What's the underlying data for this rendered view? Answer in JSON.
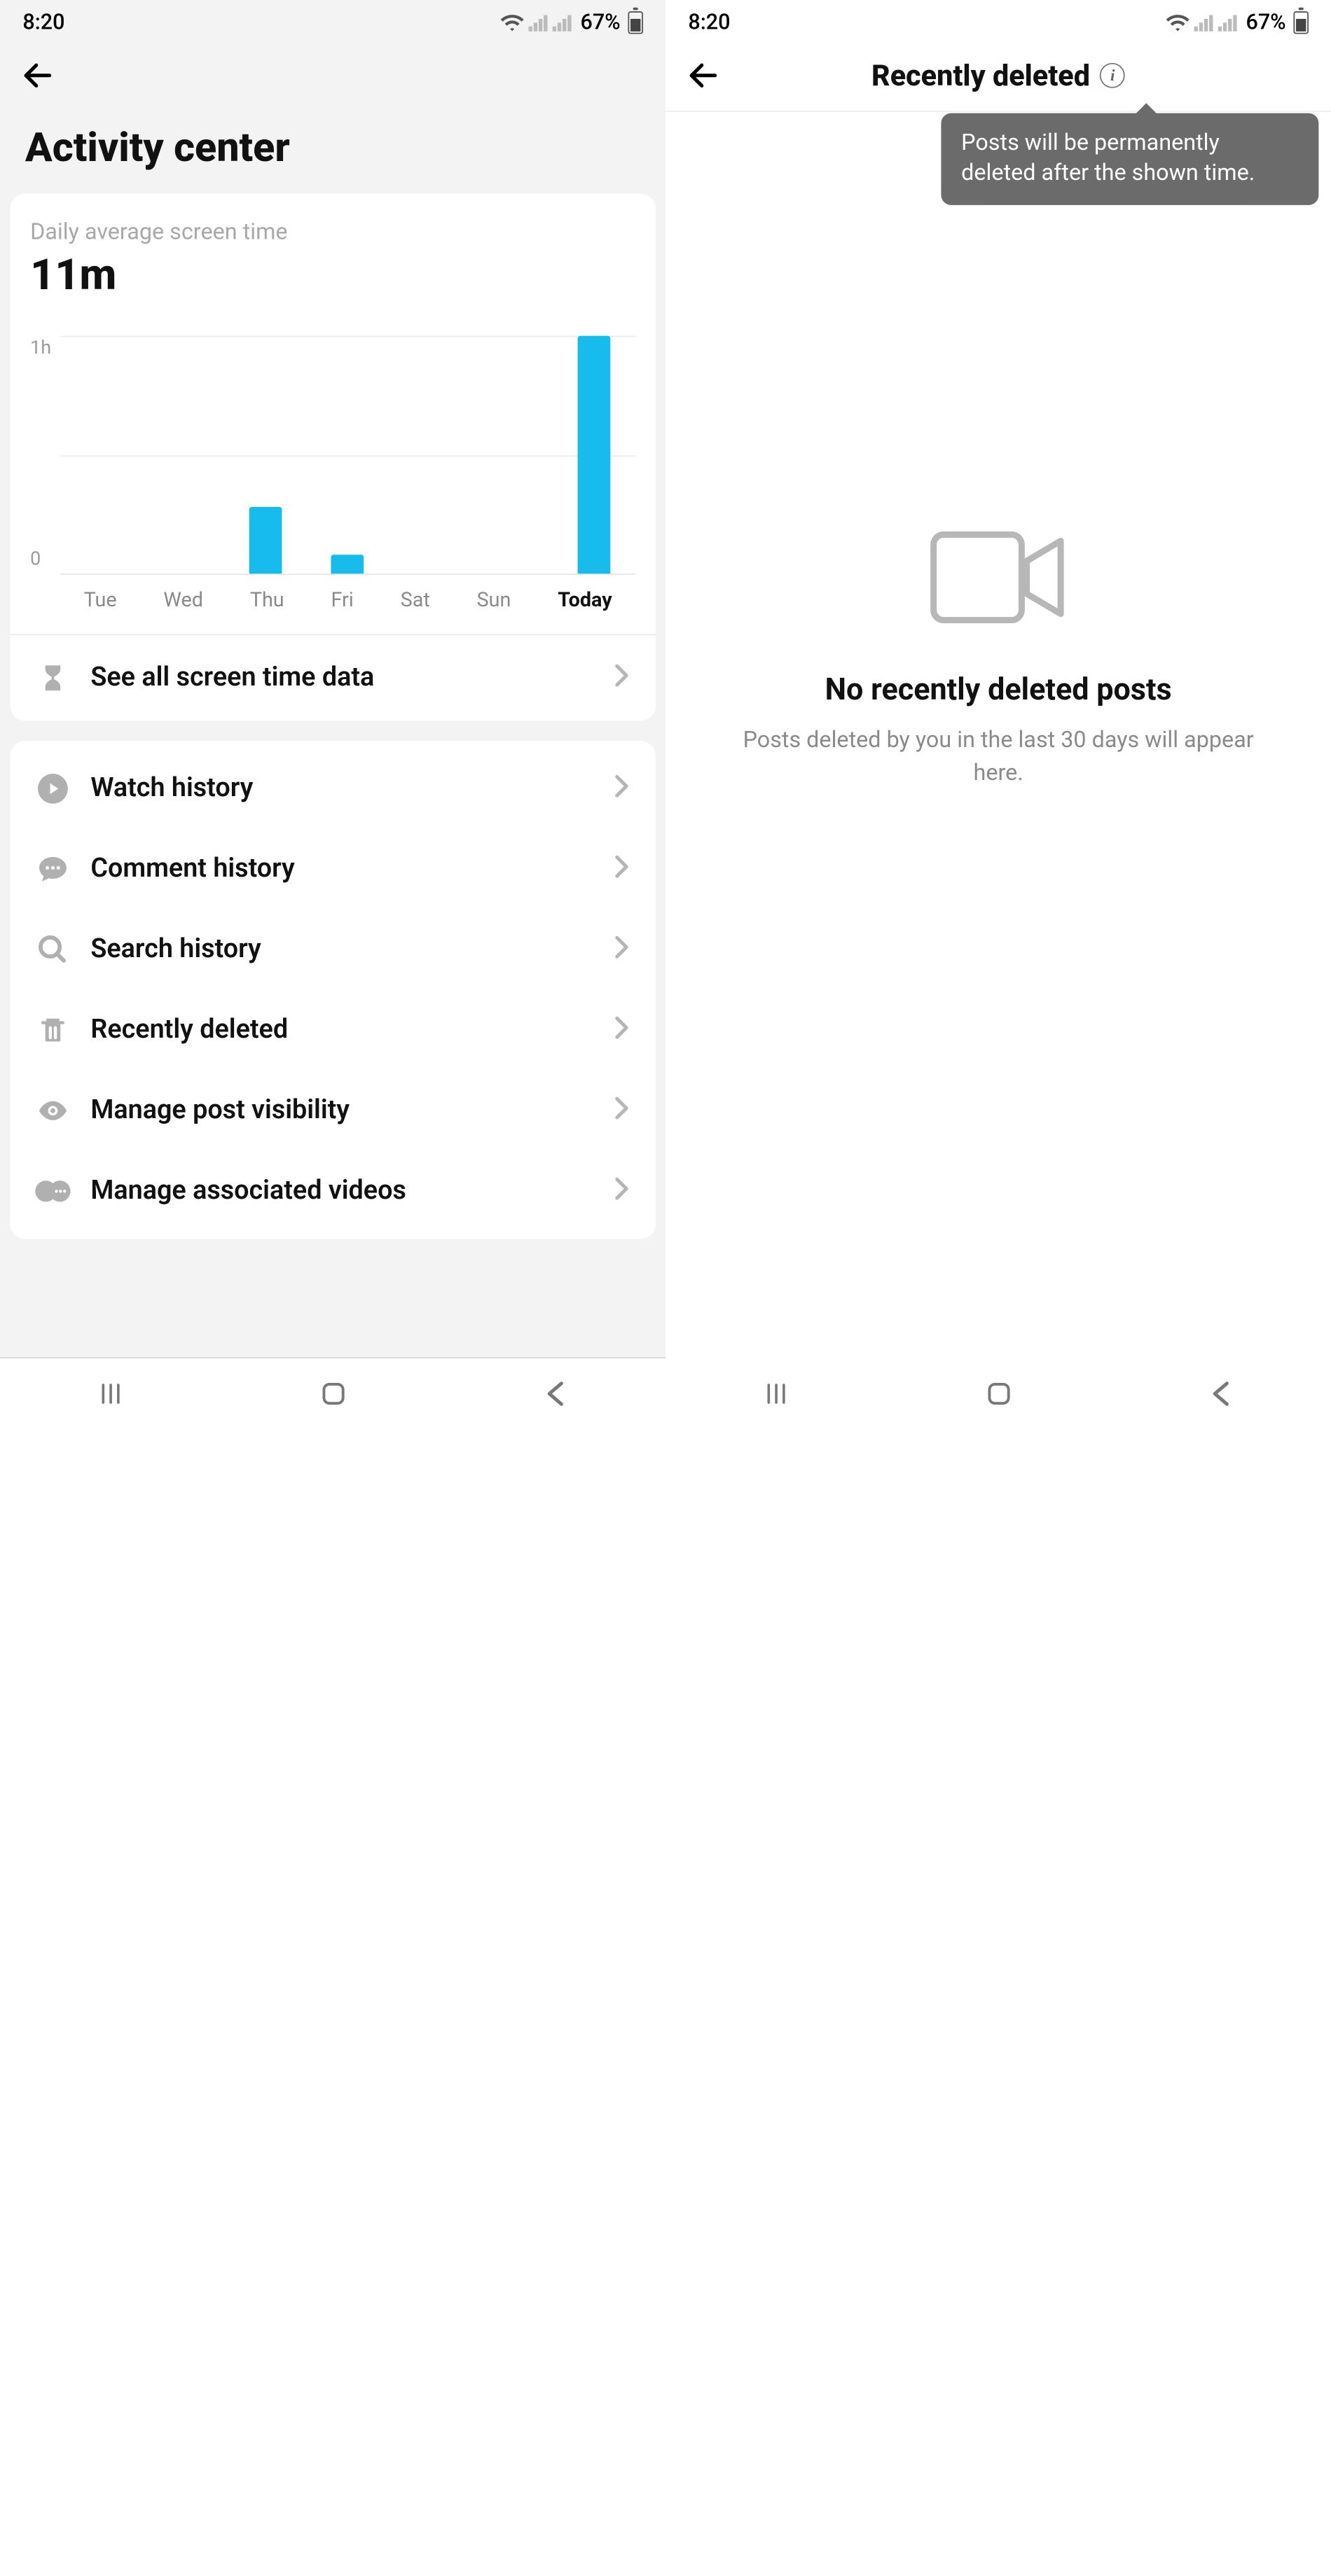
{
  "status": {
    "time": "8:20",
    "battery": "67%"
  },
  "left": {
    "title": "Activity center",
    "screen_time": {
      "label": "Daily average screen time",
      "value": "11m"
    },
    "see_all": "See all screen time data",
    "menu": [
      {
        "icon": "play",
        "label": "Watch history"
      },
      {
        "icon": "comment",
        "label": "Comment history"
      },
      {
        "icon": "search",
        "label": "Search history"
      },
      {
        "icon": "trash",
        "label": "Recently deleted"
      },
      {
        "icon": "eye",
        "label": "Manage post visibility"
      },
      {
        "icon": "link-vid",
        "label": "Manage associated videos"
      }
    ]
  },
  "right": {
    "title": "Recently deleted",
    "tooltip": "Posts will be permanently deleted after the shown time.",
    "empty_title": "No recently deleted posts",
    "empty_sub": "Posts deleted by you in the last 30 days will appear here."
  },
  "chart_data": {
    "type": "bar",
    "title": "Daily average screen time",
    "ylabel": "hours",
    "ylim": [
      0,
      1
    ],
    "y_ticks": [
      "1h",
      "0"
    ],
    "categories": [
      "Tue",
      "Wed",
      "Thu",
      "Fri",
      "Sat",
      "Sun",
      "Today"
    ],
    "values": [
      0,
      0,
      0.28,
      0.08,
      0,
      0,
      1.0
    ]
  }
}
